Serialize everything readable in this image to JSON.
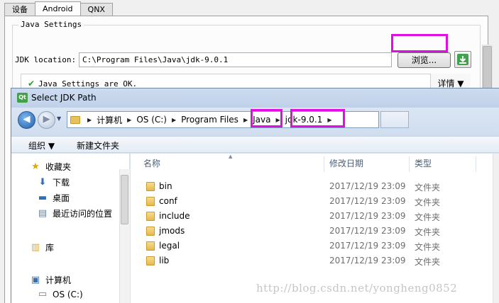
{
  "settings": {
    "tabs": [
      "设备",
      "Android",
      "QNX"
    ],
    "active_tab": "Android",
    "group_title": "Java Settings",
    "jdk_label": "JDK location:",
    "jdk_value": "C:\\Program Files\\Java\\jdk-9.0.1",
    "browse_label": "浏览...",
    "status_text": "Java Settings are OK.",
    "details_label": "详情 ▼"
  },
  "dialog": {
    "title": "Select JDK Path",
    "logo_text": "Qt",
    "breadcrumb": [
      "计算机",
      "OS (C:)",
      "Program Files",
      "Java",
      "jdk-9.0.1"
    ],
    "toolbar": {
      "organize": "组织 ▼",
      "new_folder": "新建文件夹"
    },
    "nav": {
      "favorites": "收藏夹",
      "downloads": "下载",
      "desktop": "桌面",
      "recent": "最近访问的位置",
      "libraries": "库",
      "computer": "计算机",
      "os_drive": "OS (C:)"
    },
    "columns": {
      "name": "名称",
      "modified": "修改日期",
      "type": "类型"
    },
    "files": [
      {
        "name": "bin",
        "modified": "2017/12/19 23:09",
        "type": "文件夹"
      },
      {
        "name": "conf",
        "modified": "2017/12/19 23:09",
        "type": "文件夹"
      },
      {
        "name": "include",
        "modified": "2017/12/19 23:09",
        "type": "文件夹"
      },
      {
        "name": "jmods",
        "modified": "2017/12/19 23:09",
        "type": "文件夹"
      },
      {
        "name": "legal",
        "modified": "2017/12/19 23:09",
        "type": "文件夹"
      },
      {
        "name": "lib",
        "modified": "2017/12/19 23:09",
        "type": "文件夹"
      }
    ]
  },
  "watermark": "http://blog.csdn.net/yongheng0852",
  "colors": {
    "highlight": "#e00ee0",
    "ok_check": "#2a9d2a"
  }
}
